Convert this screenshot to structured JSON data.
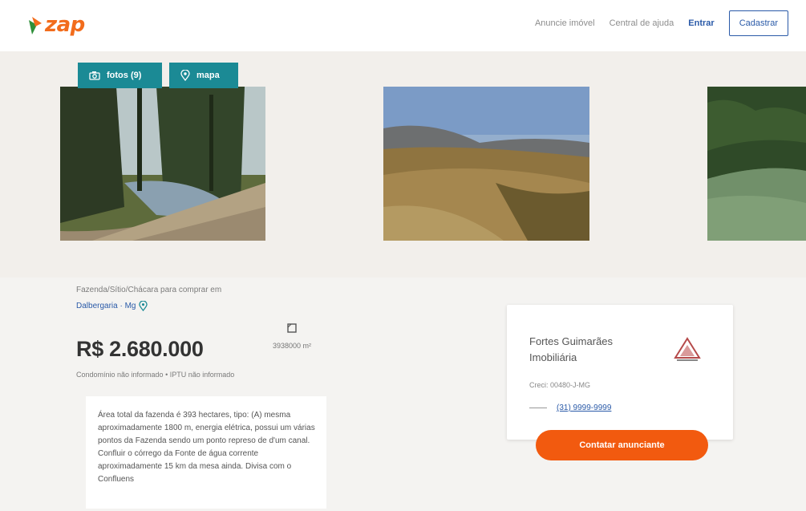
{
  "header": {
    "logo_text": "zap",
    "nav": [
      {
        "label": "Anuncie imóvel",
        "style": "muted"
      },
      {
        "label": "Central de ajuda",
        "style": "muted"
      },
      {
        "label": "Entrar",
        "style": "strong"
      },
      {
        "label": "Cadastrar",
        "style": "outline"
      }
    ],
    "brand_color": "#f26c1c",
    "link_color": "#2a5aa8"
  },
  "gallery": {
    "photos_button": "fotos (9)",
    "map_button": "mapa",
    "button_color": "#1b8a95",
    "photos": [
      "trees-road-photo",
      "field-hills-photo",
      "lake-forest-photo"
    ]
  },
  "listing": {
    "address_line1": "Fazenda/Sítio/Chácara para comprar em",
    "address_line2": "Dalbergaria · Mg",
    "price": "R$ 2.680.000",
    "area": "3938000 m²",
    "fees": "Condomínio não informado  •  IPTU não informado",
    "description": "Área total da fazenda é 393 hectares, tipo: (A) mesma aproximadamente 1800 m, energia elétrica, possui um várias pontos da Fazenda sendo um ponto represo de d'um canal. Confluir o córrego da Fonte de água corrente aproximadamente 15 km da mesa ainda. Divisa com o Confluens"
  },
  "agency": {
    "name": "Fortes Guimarães Imobiliária",
    "creci": "Creci: 00480-J-MG",
    "phone": "(31) 9999-9999",
    "contact_button": "Contatar anunciante",
    "button_color": "#f25a0f"
  }
}
